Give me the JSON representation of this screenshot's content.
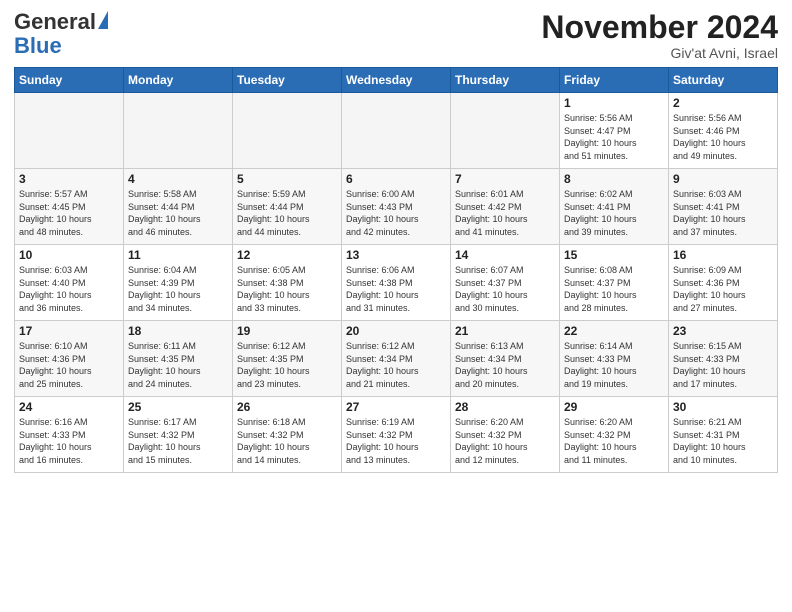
{
  "logo": {
    "line1": "General",
    "line2": "Blue"
  },
  "title": "November 2024",
  "location": "Giv'at Avni, Israel",
  "days_of_week": [
    "Sunday",
    "Monday",
    "Tuesday",
    "Wednesday",
    "Thursday",
    "Friday",
    "Saturday"
  ],
  "weeks": [
    [
      {
        "num": "",
        "info": ""
      },
      {
        "num": "",
        "info": ""
      },
      {
        "num": "",
        "info": ""
      },
      {
        "num": "",
        "info": ""
      },
      {
        "num": "",
        "info": ""
      },
      {
        "num": "1",
        "info": "Sunrise: 5:56 AM\nSunset: 4:47 PM\nDaylight: 10 hours\nand 51 minutes."
      },
      {
        "num": "2",
        "info": "Sunrise: 5:56 AM\nSunset: 4:46 PM\nDaylight: 10 hours\nand 49 minutes."
      }
    ],
    [
      {
        "num": "3",
        "info": "Sunrise: 5:57 AM\nSunset: 4:45 PM\nDaylight: 10 hours\nand 48 minutes."
      },
      {
        "num": "4",
        "info": "Sunrise: 5:58 AM\nSunset: 4:44 PM\nDaylight: 10 hours\nand 46 minutes."
      },
      {
        "num": "5",
        "info": "Sunrise: 5:59 AM\nSunset: 4:44 PM\nDaylight: 10 hours\nand 44 minutes."
      },
      {
        "num": "6",
        "info": "Sunrise: 6:00 AM\nSunset: 4:43 PM\nDaylight: 10 hours\nand 42 minutes."
      },
      {
        "num": "7",
        "info": "Sunrise: 6:01 AM\nSunset: 4:42 PM\nDaylight: 10 hours\nand 41 minutes."
      },
      {
        "num": "8",
        "info": "Sunrise: 6:02 AM\nSunset: 4:41 PM\nDaylight: 10 hours\nand 39 minutes."
      },
      {
        "num": "9",
        "info": "Sunrise: 6:03 AM\nSunset: 4:41 PM\nDaylight: 10 hours\nand 37 minutes."
      }
    ],
    [
      {
        "num": "10",
        "info": "Sunrise: 6:03 AM\nSunset: 4:40 PM\nDaylight: 10 hours\nand 36 minutes."
      },
      {
        "num": "11",
        "info": "Sunrise: 6:04 AM\nSunset: 4:39 PM\nDaylight: 10 hours\nand 34 minutes."
      },
      {
        "num": "12",
        "info": "Sunrise: 6:05 AM\nSunset: 4:38 PM\nDaylight: 10 hours\nand 33 minutes."
      },
      {
        "num": "13",
        "info": "Sunrise: 6:06 AM\nSunset: 4:38 PM\nDaylight: 10 hours\nand 31 minutes."
      },
      {
        "num": "14",
        "info": "Sunrise: 6:07 AM\nSunset: 4:37 PM\nDaylight: 10 hours\nand 30 minutes."
      },
      {
        "num": "15",
        "info": "Sunrise: 6:08 AM\nSunset: 4:37 PM\nDaylight: 10 hours\nand 28 minutes."
      },
      {
        "num": "16",
        "info": "Sunrise: 6:09 AM\nSunset: 4:36 PM\nDaylight: 10 hours\nand 27 minutes."
      }
    ],
    [
      {
        "num": "17",
        "info": "Sunrise: 6:10 AM\nSunset: 4:36 PM\nDaylight: 10 hours\nand 25 minutes."
      },
      {
        "num": "18",
        "info": "Sunrise: 6:11 AM\nSunset: 4:35 PM\nDaylight: 10 hours\nand 24 minutes."
      },
      {
        "num": "19",
        "info": "Sunrise: 6:12 AM\nSunset: 4:35 PM\nDaylight: 10 hours\nand 23 minutes."
      },
      {
        "num": "20",
        "info": "Sunrise: 6:12 AM\nSunset: 4:34 PM\nDaylight: 10 hours\nand 21 minutes."
      },
      {
        "num": "21",
        "info": "Sunrise: 6:13 AM\nSunset: 4:34 PM\nDaylight: 10 hours\nand 20 minutes."
      },
      {
        "num": "22",
        "info": "Sunrise: 6:14 AM\nSunset: 4:33 PM\nDaylight: 10 hours\nand 19 minutes."
      },
      {
        "num": "23",
        "info": "Sunrise: 6:15 AM\nSunset: 4:33 PM\nDaylight: 10 hours\nand 17 minutes."
      }
    ],
    [
      {
        "num": "24",
        "info": "Sunrise: 6:16 AM\nSunset: 4:33 PM\nDaylight: 10 hours\nand 16 minutes."
      },
      {
        "num": "25",
        "info": "Sunrise: 6:17 AM\nSunset: 4:32 PM\nDaylight: 10 hours\nand 15 minutes."
      },
      {
        "num": "26",
        "info": "Sunrise: 6:18 AM\nSunset: 4:32 PM\nDaylight: 10 hours\nand 14 minutes."
      },
      {
        "num": "27",
        "info": "Sunrise: 6:19 AM\nSunset: 4:32 PM\nDaylight: 10 hours\nand 13 minutes."
      },
      {
        "num": "28",
        "info": "Sunrise: 6:20 AM\nSunset: 4:32 PM\nDaylight: 10 hours\nand 12 minutes."
      },
      {
        "num": "29",
        "info": "Sunrise: 6:20 AM\nSunset: 4:32 PM\nDaylight: 10 hours\nand 11 minutes."
      },
      {
        "num": "30",
        "info": "Sunrise: 6:21 AM\nSunset: 4:31 PM\nDaylight: 10 hours\nand 10 minutes."
      }
    ]
  ]
}
